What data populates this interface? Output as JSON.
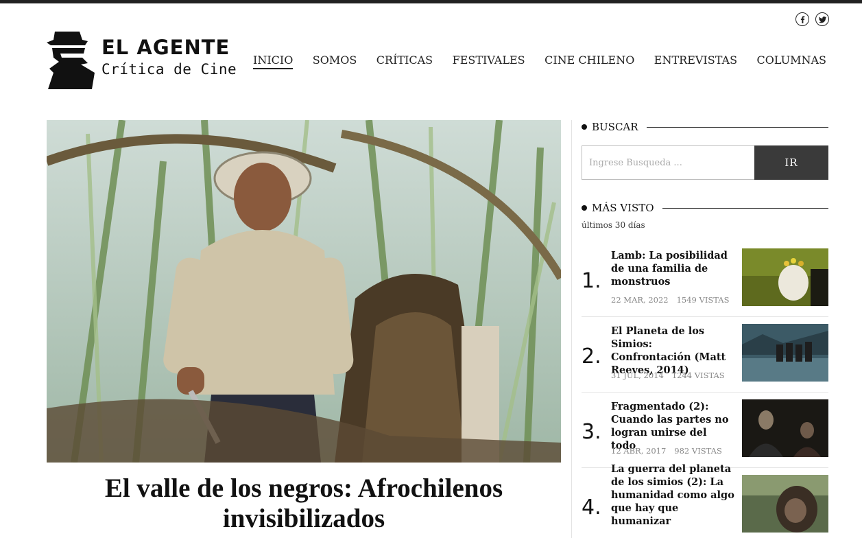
{
  "site": {
    "logo_title": "EL AGENTE",
    "logo_subtitle": "Crítica de Cine"
  },
  "social": {
    "icons": [
      "facebook-icon",
      "twitter-icon"
    ]
  },
  "nav": {
    "items": [
      {
        "label": "INICIO",
        "active": true
      },
      {
        "label": "SOMOS"
      },
      {
        "label": "CRÍTICAS"
      },
      {
        "label": "FESTIVALES"
      },
      {
        "label": "CINE CHILENO"
      },
      {
        "label": "ENTREVISTAS"
      },
      {
        "label": "COLUMNAS"
      }
    ]
  },
  "featured": {
    "title": "El valle de los negros: Afrochilenos invisibilizados"
  },
  "sidebar": {
    "search": {
      "heading": "BUSCAR",
      "placeholder": "Ingrese Busqueda ...",
      "button": "IR"
    },
    "most_viewed": {
      "heading": "MÁS VISTO",
      "subtitle": "últimos 30 días",
      "items": [
        {
          "rank": "1.",
          "title": "Lamb: La posibilidad de una familia de monstruos",
          "date": "22 MAR, 2022",
          "views": "1549 VISTAS"
        },
        {
          "rank": "2.",
          "title": "El Planeta de los Simios: Confrontación (Matt Reeves, 2014)",
          "date": "31 JUL, 2014",
          "views": "1244 VISTAS"
        },
        {
          "rank": "3.",
          "title": "Fragmentado (2): Cuando las partes no logran unirse del todo",
          "date": "12 ABR, 2017",
          "views": "982 VISTAS"
        },
        {
          "rank": "4.",
          "title": "La guerra del planeta de los simios (2): La humanidad como algo que hay que humanizar",
          "date": "",
          "views": ""
        }
      ]
    }
  }
}
